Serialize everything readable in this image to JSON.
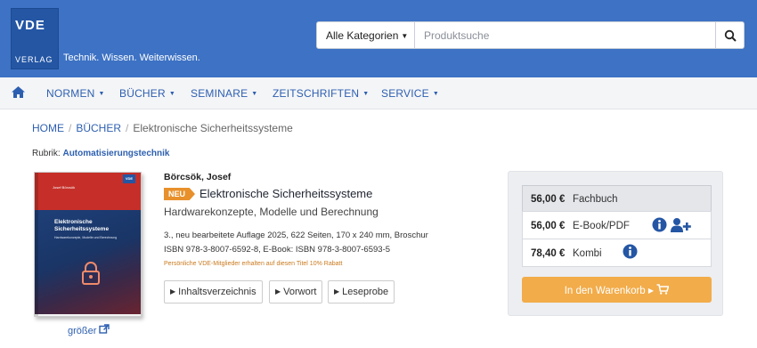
{
  "header": {
    "logo_top": "VDE",
    "logo_bottom": "VERLAG",
    "slogan": "Technik. Wissen. Weiterwissen.",
    "category_select": "Alle Kategorien",
    "search_placeholder": "Produktsuche",
    "brand_color": "#3d72c4"
  },
  "nav": {
    "items": [
      "NORMEN",
      "BÜCHER",
      "SEMINARE",
      "ZEITSCHRIFTEN",
      "SERVICE"
    ]
  },
  "breadcrumb": {
    "home": "HOME",
    "books": "BÜCHER",
    "current": "Elektronische Sicherheitssysteme"
  },
  "rubrik": {
    "label": "Rubrik:",
    "value": "Automatisierungstechnik"
  },
  "cover": {
    "author": "Josef Börcsök",
    "badge": "VDE",
    "title_line1": "Elektronische",
    "title_line2": "Sicherheitssysteme",
    "subtitle": "Hardwarekonzepte, Modelle und Berechnung",
    "bigger_link": "größer"
  },
  "product": {
    "author": "Börcsök, Josef",
    "badge": "NEU",
    "title": "Elektronische Sicherheitssysteme",
    "subtitle": "Hardwarekonzepte, Modelle und Berechnung",
    "edition": "3., neu bearbeitete Auflage 2025, 622 Seiten, 170 x 240 mm, Broschur",
    "isbn": "ISBN 978-3-8007-6592-8, E-Book: ISBN 978-3-8007-6593-5",
    "discount": "Persönliche VDE-Mitglieder erhalten auf diesen Titel 10% Rabatt",
    "buttons": [
      "Inhaltsverzeichnis",
      "Vorwort",
      "Leseprobe"
    ]
  },
  "prices": [
    {
      "value": "56,00 €",
      "type": "Fachbuch"
    },
    {
      "value": "56,00 €",
      "type": "E-Book/PDF"
    },
    {
      "value": "78,40 €",
      "type": "Kombi"
    }
  ],
  "cart_button": "In den Warenkorb",
  "colors": {
    "accent": "#2d5fb0",
    "cart": "#f2ac4a",
    "neu_badge": "#e8902b"
  }
}
